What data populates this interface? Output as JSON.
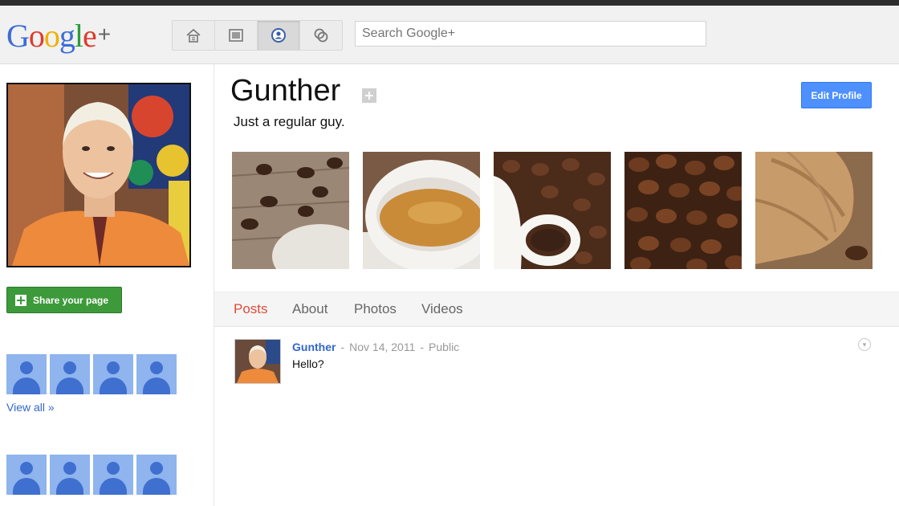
{
  "logo": {
    "letters": [
      "G",
      "o",
      "o",
      "g",
      "l",
      "e",
      "+"
    ],
    "colors": [
      "#3b6dd6",
      "#dd3c2e",
      "#f1b000",
      "#3b6dd6",
      "#2b9b3b",
      "#dd3c2e",
      "#666666"
    ]
  },
  "nav": {
    "items": [
      "home-icon",
      "photos-icon",
      "profile-icon",
      "circles-icon"
    ],
    "active": "profile-icon"
  },
  "search": {
    "placeholder": "Search Google+"
  },
  "sidebar": {
    "share_label": "Share your page",
    "view_all_label": "View all »"
  },
  "profile": {
    "name": "Gunther",
    "tagline": "Just a regular guy.",
    "edit_label": "Edit Profile"
  },
  "tabs": [
    {
      "label": "Posts",
      "active": true
    },
    {
      "label": "About",
      "active": false
    },
    {
      "label": "Photos",
      "active": false
    },
    {
      "label": "Videos",
      "active": false
    }
  ],
  "post": {
    "author": "Gunther",
    "date": "Nov 14, 2011",
    "visibility": "Public",
    "text": "Hello?",
    "separator": "-"
  },
  "colors": {
    "accent_blue": "#4d90fe",
    "share_green": "#3d9a3a",
    "active_tab": "#dd4b39",
    "link": "#3366cc"
  }
}
